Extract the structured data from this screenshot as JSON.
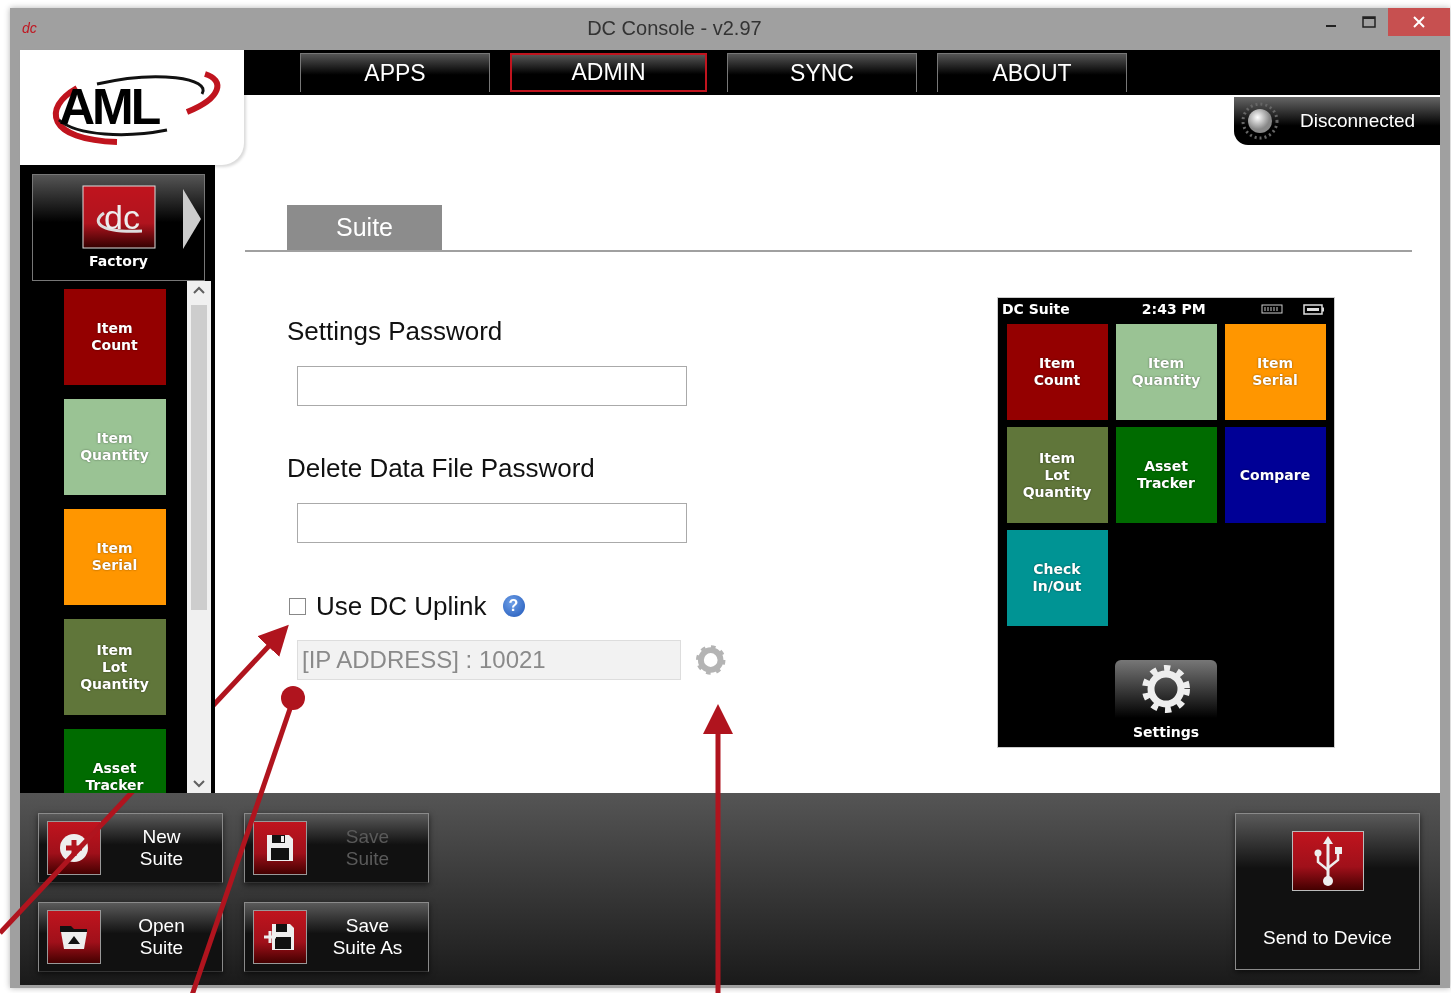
{
  "window": {
    "title": "DC Console - v2.97",
    "icon_text": "dc"
  },
  "logo": {
    "text": "AML"
  },
  "nav_tabs": [
    {
      "label": "APPS",
      "selected": false
    },
    {
      "label": "ADMIN",
      "selected": true
    },
    {
      "label": "SYNC",
      "selected": false
    },
    {
      "label": "ABOUT",
      "selected": false
    }
  ],
  "connection": {
    "label": "Disconnected",
    "connected": false
  },
  "sidebar": {
    "profile": {
      "logo_text": "dc",
      "label": "Factory"
    },
    "items": [
      {
        "label": "Item\nCount",
        "color": "#940000"
      },
      {
        "label": "Item\nQuantity",
        "color": "#9ac394"
      },
      {
        "label": "Item\nSerial",
        "color": "#ff9600"
      },
      {
        "label": "Item\nLot\nQuantity",
        "color": "#60763a"
      },
      {
        "label": "Asset\nTracker",
        "color": "#006b00"
      }
    ]
  },
  "tabs": [
    {
      "label": "Suite",
      "selected": true
    }
  ],
  "form": {
    "settings_password": {
      "label": "Settings Password"
    },
    "delete_password": {
      "label": "Delete Data File Password"
    },
    "uplink": {
      "label": "Use DC Uplink",
      "checked": false,
      "help": "?"
    },
    "address": {
      "placeholder": "[IP ADDRESS] : 10021",
      "disabled": true
    }
  },
  "device": {
    "title": "DC Suite",
    "time": "2:43 PM",
    "settings_label": "Settings",
    "apps": [
      {
        "label": "Item\nCount",
        "color": "#940000"
      },
      {
        "label": "Item\nQuantity",
        "color": "#9ac394"
      },
      {
        "label": "Item\nSerial",
        "color": "#ff9600"
      },
      {
        "label": "Item\nLot\nQuantity",
        "color": "#60763a"
      },
      {
        "label": "Asset\nTracker",
        "color": "#006b00"
      },
      {
        "label": "Compare",
        "color": "#000096"
      },
      {
        "label": "Check\nIn/Out",
        "color": "#009494"
      }
    ]
  },
  "actions": [
    {
      "label": "New\nSuite",
      "kind": "new",
      "disabled": false
    },
    {
      "label": "Save\nSuite",
      "kind": "save",
      "disabled": true
    },
    {
      "label": "Open\nSuite",
      "kind": "open",
      "disabled": false
    },
    {
      "label": "Save\nSuite As",
      "kind": "save_as",
      "disabled": false
    }
  ],
  "send": {
    "label": "Send to Device"
  }
}
